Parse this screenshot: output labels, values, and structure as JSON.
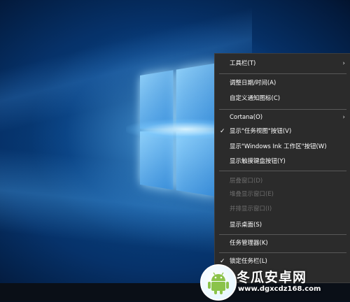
{
  "context_menu": {
    "items": [
      {
        "label": "工具栏(T)",
        "checked": false,
        "disabled": false,
        "submenu": true
      },
      {
        "label": "调整日期/时间(A)",
        "checked": false,
        "disabled": false,
        "submenu": false
      },
      {
        "label": "自定义通知图标(C)",
        "checked": false,
        "disabled": false,
        "submenu": false
      },
      {
        "label": "Cortana(O)",
        "checked": false,
        "disabled": false,
        "submenu": true
      },
      {
        "label": "显示\"任务视图\"按钮(V)",
        "checked": true,
        "disabled": false,
        "submenu": false
      },
      {
        "label": "显示\"Windows Ink 工作区\"按钮(W)",
        "checked": false,
        "disabled": false,
        "submenu": false
      },
      {
        "label": "显示触摸键盘按钮(Y)",
        "checked": false,
        "disabled": false,
        "submenu": false
      },
      {
        "label": "层叠窗口(D)",
        "checked": false,
        "disabled": true,
        "submenu": false
      },
      {
        "label": "堆叠显示窗口(E)",
        "checked": false,
        "disabled": true,
        "submenu": false
      },
      {
        "label": "并排显示窗口(I)",
        "checked": false,
        "disabled": true,
        "submenu": false
      },
      {
        "label": "显示桌面(S)",
        "checked": false,
        "disabled": false,
        "submenu": false
      },
      {
        "label": "任务管理器(K)",
        "checked": false,
        "disabled": false,
        "submenu": false
      },
      {
        "label": "锁定任务栏(L)",
        "checked": true,
        "disabled": false,
        "submenu": false
      }
    ],
    "check_glyph": "✓",
    "arrow_glyph": "›"
  },
  "watermark": {
    "title": "冬瓜安卓网",
    "url": "www.dgxcdz168.com",
    "icon": "android-logo-icon"
  },
  "colors": {
    "menu_bg": "#2b2b2b",
    "menu_text": "#ffffff",
    "menu_disabled_text": "#6d6d6d",
    "separator": "#585858",
    "desktop_blue": "#0b4f93",
    "taskbar": "#0a0f17",
    "android_green": "#8bc34a"
  }
}
